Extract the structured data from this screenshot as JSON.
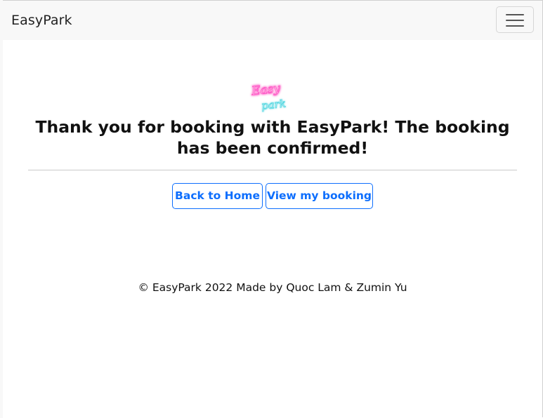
{
  "navbar": {
    "brand": "EasyPark"
  },
  "logo": {
    "line1": "Easy",
    "line2": "park",
    "color_top": "#ff4fc3",
    "color_bottom": "#4fd6e0"
  },
  "main": {
    "headline": "Thank you for booking with EasyPark! The booking has been confirmed!",
    "buttons": {
      "home_label": "Back to Home",
      "view_label": "View my booking"
    }
  },
  "footer": {
    "text": "© EasyPark 2022 Made by Quoc Lam & Zumin Yu"
  },
  "colors": {
    "accent": "#0d6efd",
    "navbar_bg": "#f8f8f8",
    "divider": "#c9c9c9"
  }
}
